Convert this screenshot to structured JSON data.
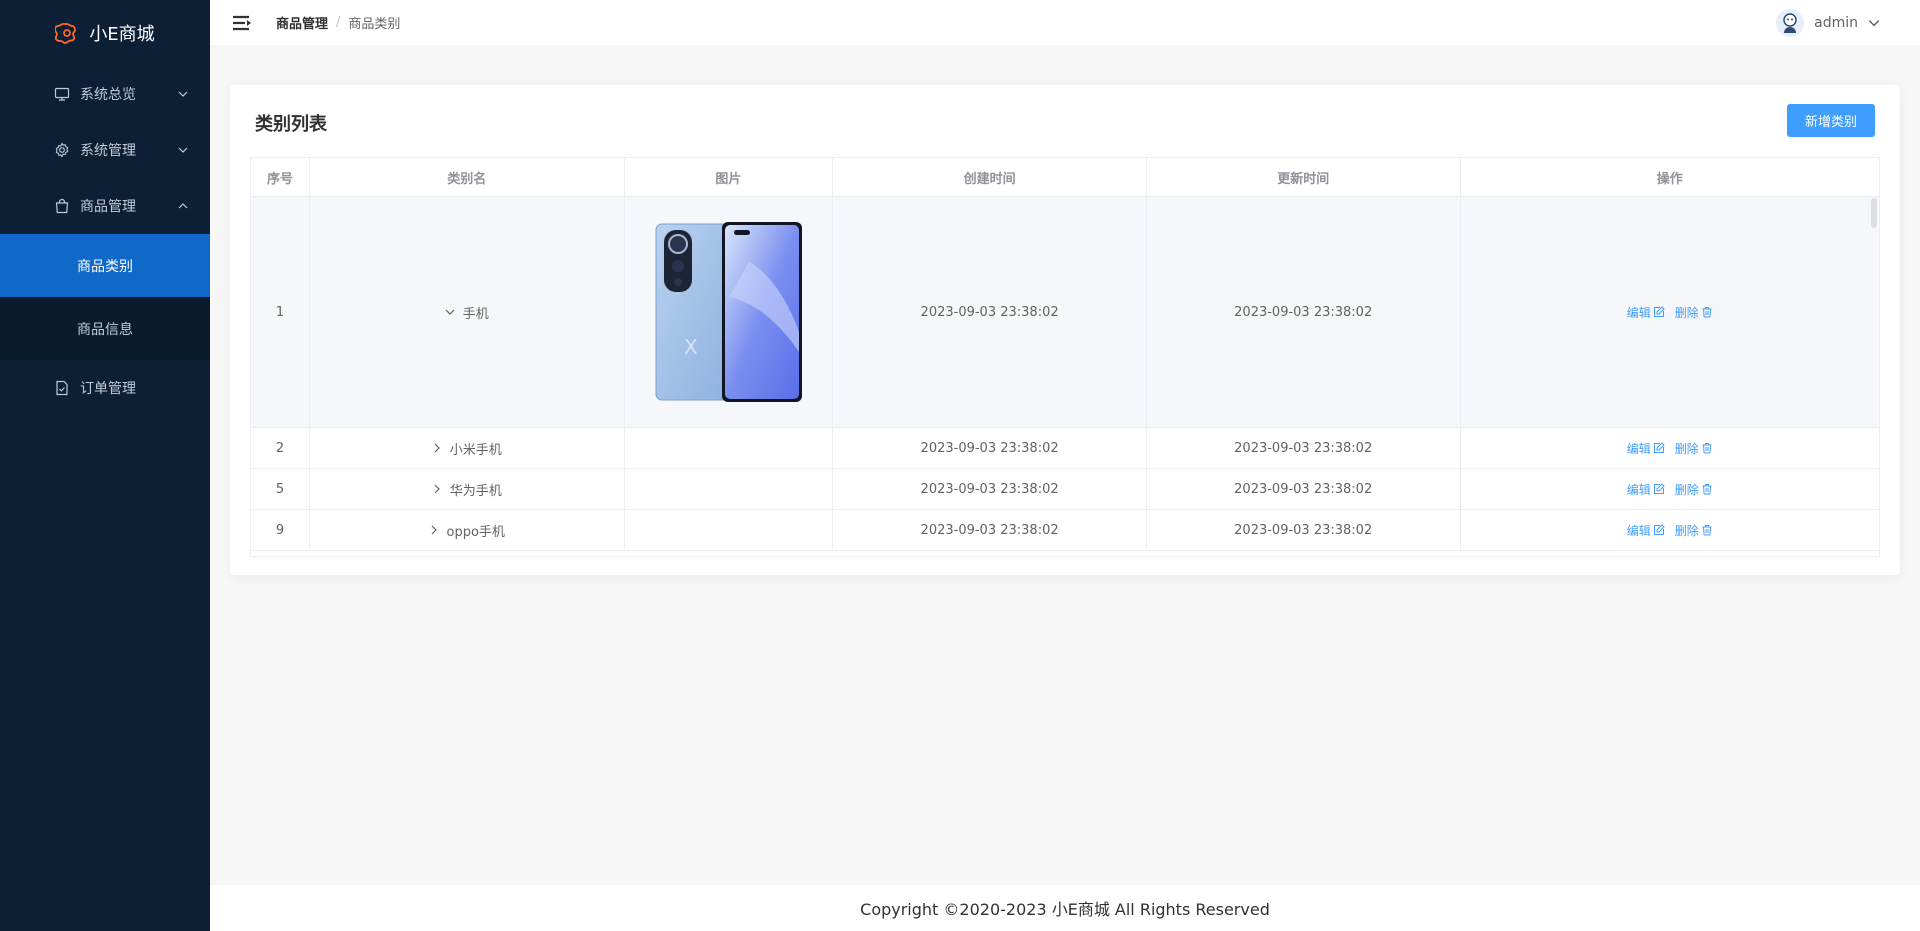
{
  "app": {
    "title": "小E商城"
  },
  "sidebar": {
    "items": [
      {
        "label": "系统总览",
        "icon": "monitor-icon"
      },
      {
        "label": "系统管理",
        "icon": "gear-icon"
      },
      {
        "label": "商品管理",
        "icon": "bag-icon",
        "sub": [
          {
            "label": "商品类别",
            "active": true
          },
          {
            "label": "商品信息"
          }
        ]
      },
      {
        "label": "订单管理",
        "icon": "document-icon"
      }
    ]
  },
  "header": {
    "breadcrumb": [
      "商品管理",
      "商品类别"
    ],
    "user": "admin"
  },
  "card": {
    "title": "类别列表",
    "add_button": "新增类别"
  },
  "table": {
    "columns": [
      "序号",
      "类别名",
      "图片",
      "创建时间",
      "更新时间",
      "操作"
    ],
    "rows": [
      {
        "id": "1",
        "name": "手机",
        "expanded": true,
        "image": "phone-image",
        "created": "2023-09-03 23:38:02",
        "updated": "2023-09-03 23:38:02"
      },
      {
        "id": "2",
        "name": "小米手机",
        "created": "2023-09-03 23:38:02",
        "updated": "2023-09-03 23:38:02"
      },
      {
        "id": "5",
        "name": "华为手机",
        "created": "2023-09-03 23:38:02",
        "updated": "2023-09-03 23:38:02"
      },
      {
        "id": "9",
        "name": "oppo手机",
        "created": "2023-09-03 23:38:02",
        "updated": "2023-09-03 23:38:02"
      }
    ],
    "edit_label": "编辑",
    "delete_label": "删除"
  },
  "footer": {
    "text": "Copyright ©2020-2023 小E商城 All Rights Reserved"
  },
  "colors": {
    "sidebar_bg": "#0d1f35",
    "active_bg": "#1068c8",
    "primary": "#409eff"
  }
}
